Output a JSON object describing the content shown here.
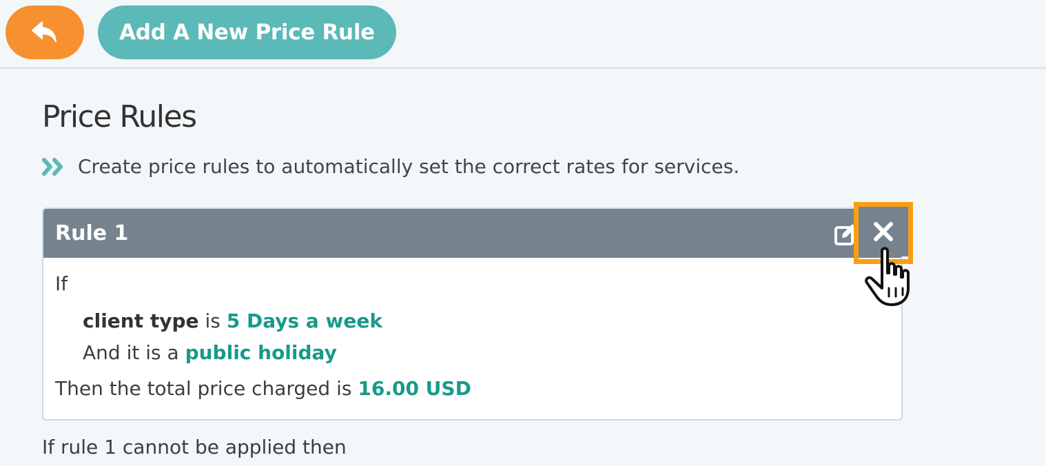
{
  "toolbar": {
    "back_icon": "reply-arrow-icon",
    "add_label": "Add A New Price Rule",
    "accent_color": "#f7902e",
    "primary_color": "#5bb9b7"
  },
  "page": {
    "title": "Price Rules",
    "subtitle_icon": "double-chevron-right-icon",
    "subtitle": "Create price rules to automatically set the correct rates for services."
  },
  "rules": [
    {
      "title": "Rule 1",
      "edit_icon": "edit-icon",
      "delete_icon": "close-icon",
      "if_label": "If",
      "condition_field": "client type",
      "condition_op": "is",
      "condition_value": "5 Days a week",
      "and_text": "And it is a",
      "and_value": "public holiday",
      "then_text": "Then the total price charged is",
      "price": "16.00 USD"
    }
  ],
  "fallback_text": "If rule 1 cannot be applied then",
  "highlight_color": "#f99d14",
  "value_color": "#179a8a"
}
